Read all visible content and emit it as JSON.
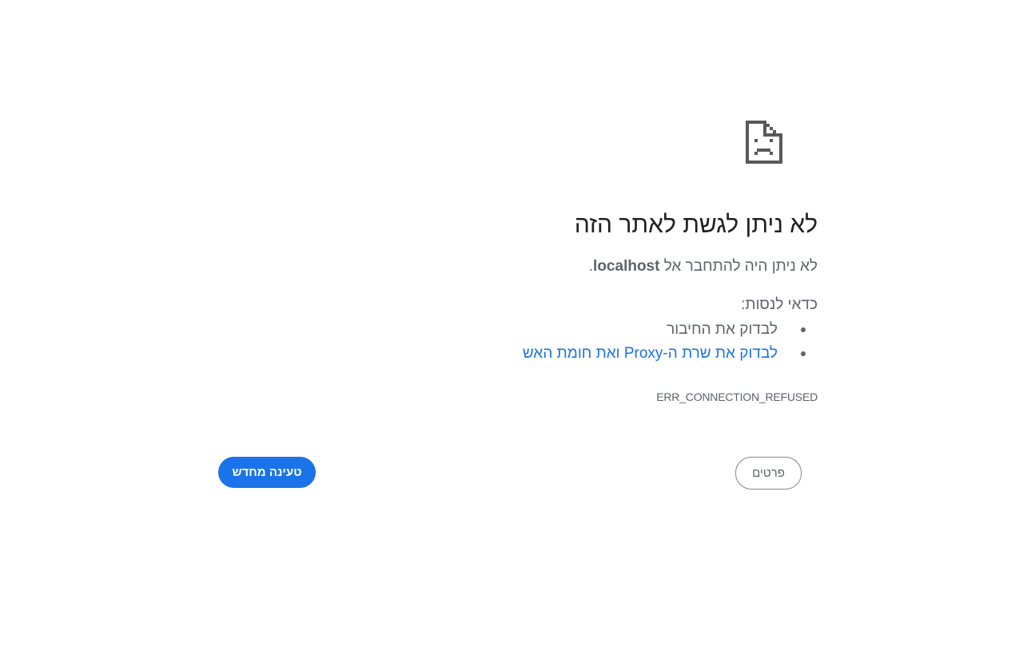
{
  "icon": {
    "name": "sad-page-icon",
    "color": "#595959"
  },
  "main": {
    "title": "לא ניתן לגשת לאתר הזה",
    "description_prefix": "לא ניתן היה להתחבר אל",
    "host": "localhost",
    "description_suffix": ".",
    "try_label": "כדאי לנסות:",
    "suggestions": [
      {
        "text": "לבדוק את החיבור",
        "is_link": false
      },
      {
        "text": "לבדוק את שרת ה-Proxy ואת חומת האש",
        "is_link": true
      }
    ],
    "error_code": "ERR_CONNECTION_REFUSED"
  },
  "buttons": {
    "reload_label": "טעינה מחדש",
    "details_label": "פרטים"
  },
  "colors": {
    "accent": "#1a73e8",
    "text_primary": "#202124",
    "text_secondary": "#5f6368"
  }
}
